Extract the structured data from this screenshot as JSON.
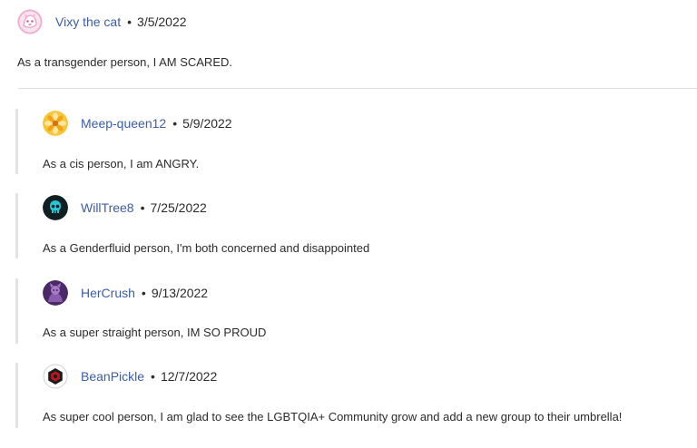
{
  "comments": [
    {
      "username": "Vixy the cat",
      "separator": "•",
      "date": "3/5/2022",
      "text": "As a transgender person, I AM SCARED.",
      "avatar_icon": "pink-cat-avatar-icon",
      "avatar_color": "#f3b8d8"
    }
  ],
  "replies": [
    {
      "username": "Meep-queen12",
      "separator": "•",
      "date": "5/9/2022",
      "text": "As a cis person, I am ANGRY.",
      "avatar_icon": "yellow-flower-avatar-icon",
      "avatar_color": "#f2b41c"
    },
    {
      "username": "WillTree8",
      "separator": "•",
      "date": "7/25/2022",
      "text": "As a Genderfluid person, I'm both concerned and disappointed",
      "avatar_icon": "teal-skull-avatar-icon",
      "avatar_color": "#17b6c4"
    },
    {
      "username": "HerCrush",
      "separator": "•",
      "date": "9/13/2022",
      "text": "As a super straight person, IM SO PROUD",
      "avatar_icon": "purple-character-avatar-icon",
      "avatar_color": "#6b3f8e"
    },
    {
      "username": "BeanPickle",
      "separator": "•",
      "date": "12/7/2022",
      "text": "As super cool person, I am glad to see the LGBTQIA+ Community grow and add a new group to their umbrella!",
      "avatar_icon": "red-hexagon-avatar-icon",
      "avatar_color": "#c0161e"
    }
  ]
}
